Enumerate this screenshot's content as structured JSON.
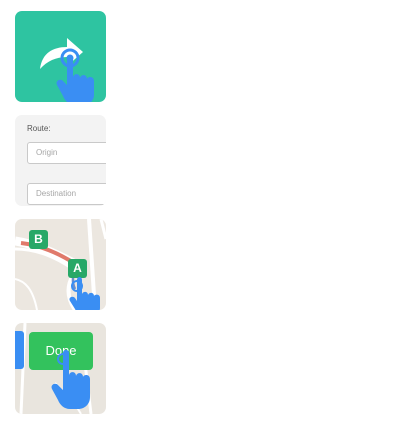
{
  "share_tile": {
    "icon": "share-arrow-icon"
  },
  "route_tile": {
    "label": "Route:",
    "origin_placeholder": "Origin",
    "destination_placeholder": "Destination"
  },
  "map_tile": {
    "pin_b": "B",
    "pin_a": "A"
  },
  "done_tile": {
    "done_label": "Done"
  },
  "colors": {
    "teal": "#2ec4a1",
    "green": "#33c25d",
    "pin_green": "#27a867",
    "hand_blue": "#3a8ef3",
    "route_red": "#e07a6b"
  }
}
